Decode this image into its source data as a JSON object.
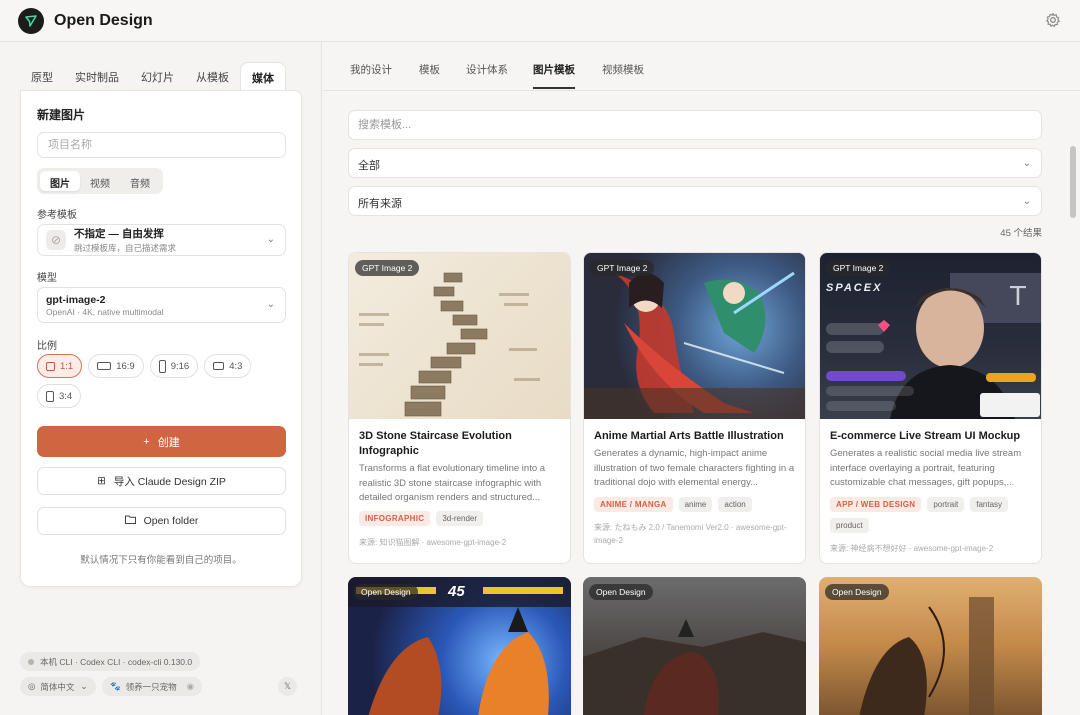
{
  "app": {
    "title": "Open Design"
  },
  "left_tabs": [
    "原型",
    "实时制品",
    "幻灯片",
    "从模板",
    "媒体"
  ],
  "new_image": {
    "title": "新建图片",
    "name_placeholder": "项目名称",
    "media_types": [
      "图片",
      "视频",
      "音频"
    ],
    "reference_label": "参考模板",
    "reference_value": "不指定 — 自由发挥",
    "reference_sub": "跳过模板库，自己描述需求",
    "model_label": "模型",
    "model_value": "gpt-image-2",
    "model_sub": "OpenAI · 4K, native multimodal",
    "ratio_label": "比例",
    "ratios": [
      "1:1",
      "16:9",
      "9:16",
      "4:3",
      "3:4"
    ],
    "create_label": "创建",
    "import_label": "导入 Claude Design ZIP",
    "open_folder_label": "Open folder",
    "note": "默认情况下只有你能看到自己的项目。"
  },
  "footer": {
    "cli": "本机 CLI · Codex CLI · codex-cli 0.130.0",
    "language": "简体中文",
    "pet": "领养一只宠物",
    "x_label": "𝕏"
  },
  "right_tabs": [
    "我的设计",
    "模板",
    "设计体系",
    "图片模板",
    "视频模板"
  ],
  "search": {
    "placeholder": "搜索模板..."
  },
  "filter_category": "全部",
  "filter_source": "所有来源",
  "result_count": "45 个结果",
  "cards": [
    {
      "tag": "GPT Image 2",
      "title": "3D Stone Staircase Evolution Infographic",
      "desc": "Transforms a flat evolutionary timeline into a realistic 3D stone staircase infographic with detailed organism renders and structured...",
      "chips": [
        "INFOGRAPHIC",
        "3d-render"
      ],
      "source": "来源: 知识猫图解 · awesome-gpt-image-2"
    },
    {
      "tag": "GPT Image 2",
      "title": "Anime Martial Arts Battle Illustration",
      "desc": "Generates a dynamic, high-impact anime illustration of two female characters fighting in a traditional dojo with elemental energy...",
      "chips": [
        "ANIME / MANGA",
        "anime",
        "action"
      ],
      "source": "来源: たねもみ 2.0 / Tanemomi Ver2.0 · awesome-gpt-image-2"
    },
    {
      "tag": "GPT Image 2",
      "title": "E-commerce Live Stream UI Mockup",
      "desc": "Generates a realistic social media live stream interface overlaying a portrait, featuring customizable chat messages, gift popups,...",
      "chips": [
        "APP / WEB DESIGN",
        "portrait",
        "fantasy",
        "product"
      ],
      "source": "来源: 神经病不想好好 · awesome-gpt-image-2"
    }
  ],
  "bottom_tags": [
    "Open Design",
    "Open Design",
    "Open Design"
  ],
  "image_texts": {
    "spacex": "SPACEX",
    "fight_number": "45"
  },
  "colors": {
    "accent": "#cf6541",
    "chip_accent": "#cd6448"
  }
}
